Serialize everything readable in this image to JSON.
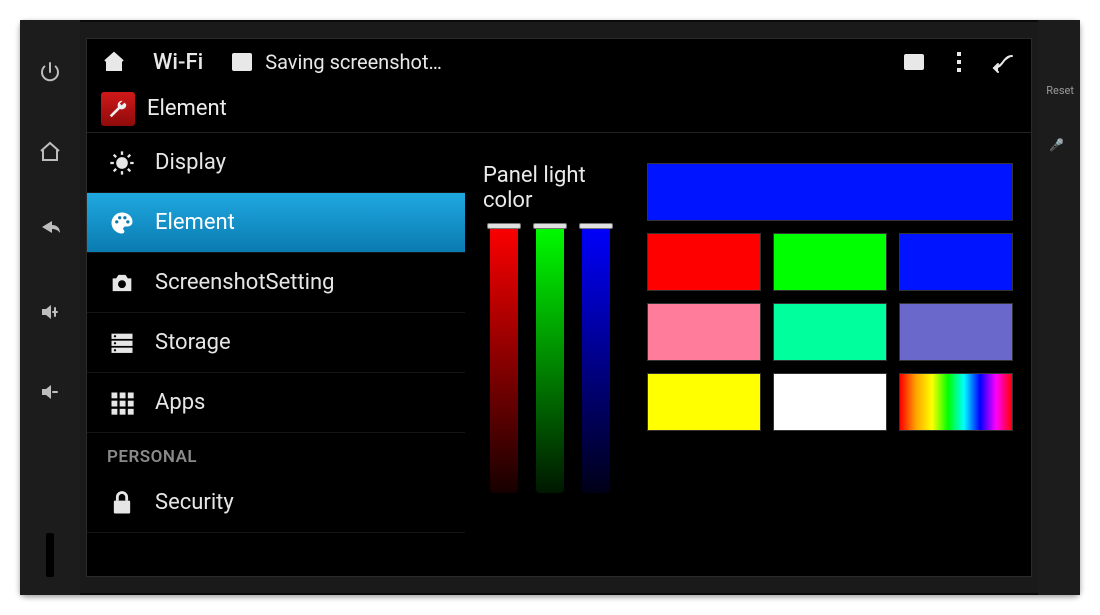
{
  "statusbar": {
    "wifi_label": "Wi-Fi",
    "toast_text": "Saving screenshot…"
  },
  "app": {
    "title": "Element"
  },
  "sidebar": {
    "items": [
      {
        "id": "display",
        "label": "Display",
        "icon": "brightness"
      },
      {
        "id": "element",
        "label": "Element",
        "icon": "palette",
        "selected": true
      },
      {
        "id": "screenshot",
        "label": "ScreenshotSetting",
        "icon": "camera"
      },
      {
        "id": "storage",
        "label": "Storage",
        "icon": "storage"
      },
      {
        "id": "apps",
        "label": "Apps",
        "icon": "apps"
      }
    ],
    "section_personal": "PERSONAL",
    "security_label": "Security"
  },
  "panel": {
    "sliders_label": "Panel light color",
    "sliders": {
      "red": {
        "value": 100
      },
      "green": {
        "value": 100
      },
      "blue": {
        "value": 100
      }
    },
    "swatches": {
      "row0": [
        {
          "color": "#0014ff",
          "wide": true
        }
      ],
      "row1": [
        {
          "color": "#ff0000"
        },
        {
          "color": "#00ff00"
        },
        {
          "color": "#0014ff"
        }
      ],
      "row2": [
        {
          "color": "#ff7d9a"
        },
        {
          "color": "#00ff9d"
        },
        {
          "color": "#6a68ca"
        }
      ],
      "row3": [
        {
          "color": "#ffff00"
        },
        {
          "color": "#ffffff"
        },
        {
          "rainbow": true
        }
      ]
    }
  },
  "hardware": {
    "reset_label": "Reset"
  }
}
